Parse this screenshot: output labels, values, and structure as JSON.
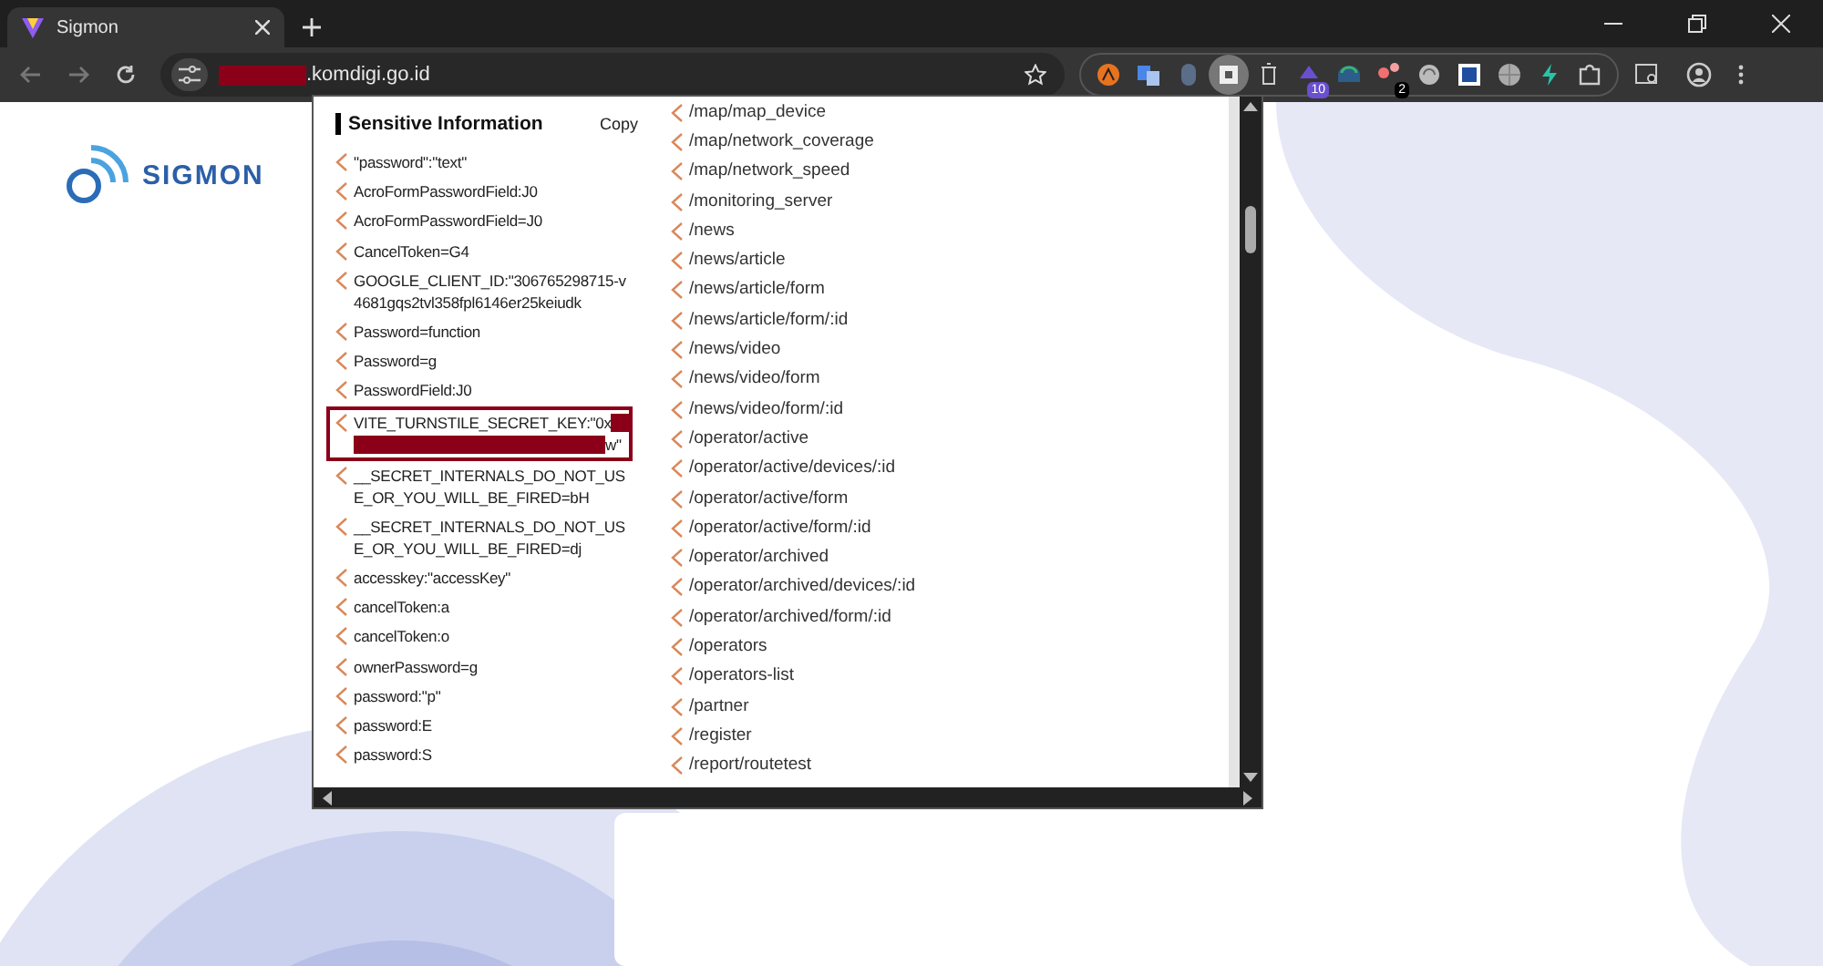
{
  "browser": {
    "tab": {
      "title": "Sigmon",
      "selected": true
    },
    "address": {
      "redacted": true,
      "text": ".komdigi.go.id"
    },
    "extensions": [
      {
        "kind": "orange"
      },
      {
        "kind": "translate"
      },
      {
        "kind": "mouse"
      },
      {
        "kind": "active"
      },
      {
        "kind": "trash"
      },
      {
        "kind": "purple",
        "badge": "10"
      },
      {
        "kind": "cloud"
      },
      {
        "kind": "red",
        "badge": "2"
      },
      {
        "kind": "shell"
      },
      {
        "kind": "square"
      },
      {
        "kind": "globe"
      },
      {
        "kind": "bolt"
      },
      {
        "kind": "puzzle"
      }
    ]
  },
  "page": {
    "logo": "SIGMON"
  },
  "popup": {
    "section_title": "Sensitive Information",
    "copy_label": "Copy",
    "items": [
      {
        "text": "\"password\":\"text\""
      },
      {
        "text": "AcroFormPasswordField:J0"
      },
      {
        "text": "AcroFormPasswordField=J0"
      },
      {
        "text": "CancelToken=G4"
      },
      {
        "text": "GOOGLE_CLIENT_ID:\"306765298715-v4681gqs2tvl358fpl6146er25keiudk"
      },
      {
        "text": "Password=function"
      },
      {
        "text": "Password=g"
      },
      {
        "text": "PasswordField:J0"
      },
      {
        "text": "VITE_TURNSTILE_SECRET_KEY:\"0x",
        "text_end": "w\"",
        "redacted": true,
        "highlighted": true
      },
      {
        "text": "__SECRET_INTERNALS_DO_NOT_USE_OR_YOU_WILL_BE_FIRED=bH"
      },
      {
        "text": "__SECRET_INTERNALS_DO_NOT_USE_OR_YOU_WILL_BE_FIRED=dj"
      },
      {
        "text": "accesskey:\"accessKey\""
      },
      {
        "text": "cancelToken:a"
      },
      {
        "text": "cancelToken:o"
      },
      {
        "text": "ownerPassword=g"
      },
      {
        "text": "password:\"p\""
      },
      {
        "text": "password:E"
      },
      {
        "text": "password:S"
      }
    ],
    "paths": [
      "/map/map_device",
      "/map/network_coverage",
      "/map/network_speed",
      "/monitoring_server",
      "/news",
      "/news/article",
      "/news/article/form",
      "/news/article/form/:id",
      "/news/video",
      "/news/video/form",
      "/news/video/form/:id",
      "/operator/active",
      "/operator/active/devices/:id",
      "/operator/active/form",
      "/operator/active/form/:id",
      "/operator/archived",
      "/operator/archived/devices/:id",
      "/operator/archived/form/:id",
      "/operators",
      "/operators-list",
      "/partner",
      "/register",
      "/report/routetest"
    ]
  }
}
